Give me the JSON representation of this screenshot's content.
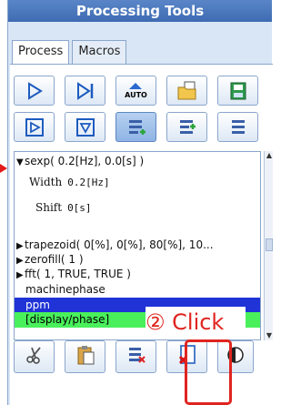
{
  "window": {
    "title": "Processing Tools"
  },
  "tabs": [
    {
      "label": "Process",
      "active": true
    },
    {
      "label": "Macros",
      "active": false
    }
  ],
  "toolbar": {
    "row1": [
      {
        "icon": "play-icon"
      },
      {
        "icon": "step-forward-icon"
      },
      {
        "icon": "auto-icon",
        "label": "AUTO"
      },
      {
        "icon": "folder-open-icon"
      },
      {
        "icon": "save-icon"
      }
    ],
    "row2": [
      {
        "icon": "step-into-icon"
      },
      {
        "icon": "step-down-icon"
      },
      {
        "icon": "insert-after-icon",
        "selected": true
      },
      {
        "icon": "insert-before-icon"
      },
      {
        "icon": "list-icon"
      }
    ]
  },
  "tree": {
    "items": [
      {
        "text": "sexp( 0.2[Hz], 0.0[s] )",
        "expanded": true
      },
      {
        "text": "trapezoid( 0[%], 0[%], 80[%], 10...",
        "expanded": false
      },
      {
        "text": "zerofill( 1 )",
        "expanded": false
      },
      {
        "text": "fft( 1, TRUE, TRUE )",
        "expanded": false
      },
      {
        "text": "machinephase"
      },
      {
        "text": "ppm",
        "highlight": "selected"
      },
      {
        "text": "[display/phase]",
        "highlight": "green"
      }
    ],
    "props": [
      {
        "name": "Width",
        "value": "0.2[Hz]"
      },
      {
        "name": "Shift",
        "value": "0[s]"
      }
    ]
  },
  "bottom_buttons": [
    {
      "icon": "scissors-icon"
    },
    {
      "icon": "paste-icon"
    },
    {
      "icon": "insert-row-icon"
    },
    {
      "icon": "delete-icon"
    },
    {
      "icon": "contrast-icon"
    }
  ],
  "annotation": {
    "click_label": "② Click",
    "color": "#e0241f"
  },
  "colors": {
    "accent": "#3e6bb2",
    "selected_row": "#1f33d6",
    "green_row": "#49f05c"
  }
}
